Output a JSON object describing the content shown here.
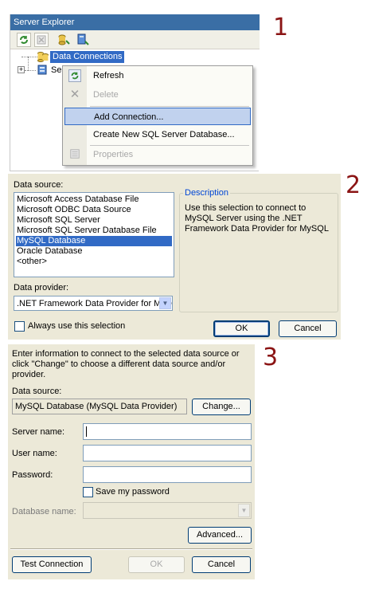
{
  "step_numbers": [
    "1",
    "2",
    "3"
  ],
  "server_explorer": {
    "title": "Server Explorer",
    "toolbar_icons": [
      "refresh-icon",
      "stop-icon",
      "connect-to-database-icon",
      "connect-to-server-icon"
    ],
    "tree": {
      "data_connections": "Data Connections",
      "servers": "Servers"
    },
    "context_menu": [
      {
        "label": "Refresh",
        "icon": "refresh-icon",
        "enabled": true
      },
      {
        "label": "Delete",
        "icon": "delete-icon",
        "enabled": false
      },
      {
        "label": "Add Connection...",
        "icon": "",
        "enabled": true,
        "highlighted": true
      },
      {
        "label": "Create New SQL Server Database...",
        "icon": "",
        "enabled": true
      },
      {
        "label": "Properties",
        "icon": "properties-icon",
        "enabled": false
      }
    ]
  },
  "change_data_source": {
    "data_source_label": "Data source:",
    "data_sources": [
      "Microsoft Access Database File",
      "Microsoft ODBC Data Source",
      "Microsoft SQL Server",
      "Microsoft SQL Server Database File",
      "MySQL Database",
      "Oracle Database",
      "<other>"
    ],
    "selected_index": 4,
    "description_title": "Description",
    "description_text": "Use this selection to connect to MySQL Server using the .NET Framework Data Provider for MySQL",
    "data_provider_label": "Data provider:",
    "data_provider_value": ".NET Framework Data Provider for MySQL",
    "always_use_label": "Always use this selection",
    "always_use_checked": false,
    "ok_label": "OK",
    "cancel_label": "Cancel"
  },
  "add_connection": {
    "intro": "Enter information to connect to the selected data source or click \"Change\" to choose a different data source and/or provider.",
    "data_source_label": "Data source:",
    "data_source_value": "MySQL Database (MySQL Data Provider)",
    "change_label": "Change...",
    "server_name_label": "Server name:",
    "server_name_value": "",
    "user_name_label": "User name:",
    "user_name_value": "",
    "password_label": "Password:",
    "password_value": "",
    "save_password_label": "Save my password",
    "save_password_checked": false,
    "database_name_label": "Database name:",
    "database_name_value": "",
    "advanced_label": "Advanced...",
    "test_connection_label": "Test Connection",
    "ok_label": "OK",
    "cancel_label": "Cancel"
  },
  "colors": {
    "step_number": "#8b1414",
    "selection": "#316ac5",
    "dialog_bg": "#ece9d8",
    "titlebar": "#3a6ea5"
  }
}
